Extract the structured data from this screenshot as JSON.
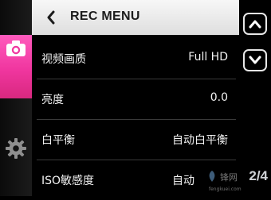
{
  "header": {
    "title": "REC MENU"
  },
  "menu": {
    "items": [
      {
        "label": "视频画质",
        "value": "Full HD"
      },
      {
        "label": "亮度",
        "value": "0.0"
      },
      {
        "label": "白平衡",
        "value": "自动白平衡"
      },
      {
        "label": "ISO敏感度",
        "value": "自动"
      }
    ]
  },
  "pager": {
    "indicator": "2/4"
  },
  "tabs": [
    {
      "icon": "camera-icon",
      "active": true,
      "color": "#f0369f"
    },
    {
      "icon": "gear-icon",
      "active": false
    }
  ],
  "scroll": {
    "up_icon": "chevron-up-icon",
    "down_icon": "chevron-down-icon"
  },
  "watermark": {
    "text": "锋网",
    "url": "fengkuei.com"
  }
}
